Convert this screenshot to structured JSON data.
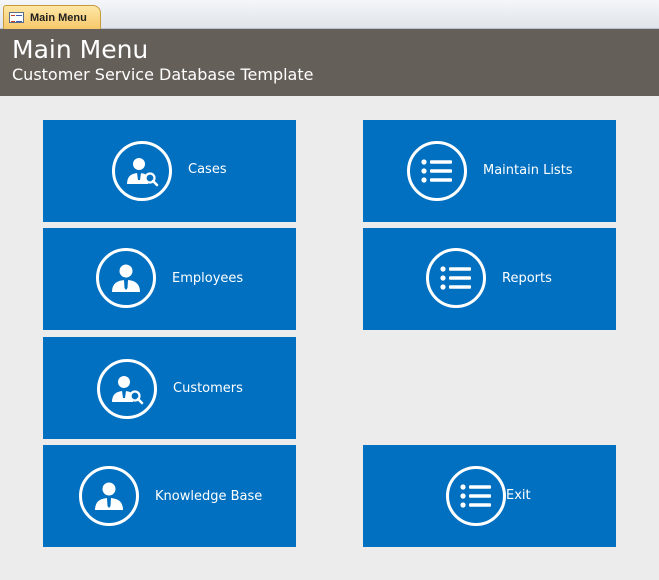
{
  "window": {
    "tab_label": "Main Menu"
  },
  "header": {
    "title": "Main Menu",
    "subtitle": "Customer Service Database Template"
  },
  "tiles": [
    {
      "label": "Cases",
      "icon": "person-search-icon"
    },
    {
      "label": "Employees",
      "icon": "person-icon"
    },
    {
      "label": "Customers",
      "icon": "person-search-icon"
    },
    {
      "label": "Knowledge Base",
      "icon": "person-icon"
    },
    {
      "label": "Maintain Lists",
      "icon": "list-icon"
    },
    {
      "label": "Reports",
      "icon": "list-icon"
    },
    {
      "label": "Exit",
      "icon": "list-icon"
    }
  ],
  "colors": {
    "tile": "#0170c0",
    "header": "#655f5a",
    "background": "#ececec"
  }
}
